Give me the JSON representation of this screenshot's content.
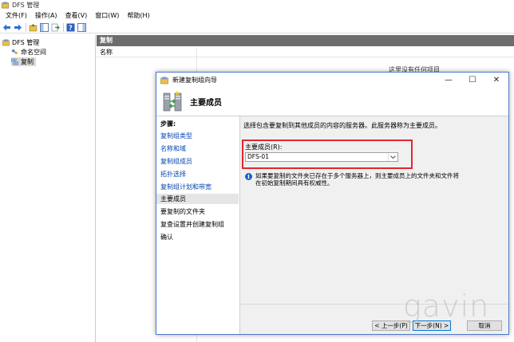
{
  "window": {
    "title": "DFS 管理"
  },
  "menu": [
    {
      "label": "文件(F)"
    },
    {
      "label": "操作(A)"
    },
    {
      "label": "查看(V)"
    },
    {
      "label": "窗口(W)"
    },
    {
      "label": "帮助(H)"
    }
  ],
  "tree": {
    "root": "DFS 管理",
    "items": [
      {
        "label": "命名空间"
      },
      {
        "label": "复制"
      }
    ]
  },
  "right_pane": {
    "header": "复制",
    "column": "名称",
    "background_text": "这里没有任何项目"
  },
  "wizard": {
    "title": "新建复制组向导",
    "page_title": "主要成员",
    "steps_title": "步骤:",
    "steps": [
      {
        "label": "复制组类型",
        "state": "done"
      },
      {
        "label": "名称和域",
        "state": "done"
      },
      {
        "label": "复制组成员",
        "state": "done"
      },
      {
        "label": "拓扑选择",
        "state": "done"
      },
      {
        "label": "复制组计划和带宽",
        "state": "done"
      },
      {
        "label": "主要成员",
        "state": "current"
      },
      {
        "label": "要复制的文件夹",
        "state": "pending"
      },
      {
        "label": "复查设置并创建复制组",
        "state": "pending"
      },
      {
        "label": "确认",
        "state": "pending"
      }
    ],
    "description": "选择包含要复制到其他成员的内容的服务器。此服务器称为主要成员。",
    "field_label": "主要成员(R):",
    "selected_member": "DFS-01",
    "info_text": "如果要复制的文件夹已存在于多个服务器上，则主要成员上的文件夹和文件将在初始复制期间具有权威性。",
    "buttons": {
      "back": "< 上一步(P)",
      "next": "下一步(N) >",
      "cancel": "取消"
    },
    "controls": {
      "minimize": "—",
      "maximize": "☐",
      "close": "✕"
    }
  },
  "watermark": "gavin",
  "colors": {
    "title_bar_header": "#6d6d6d",
    "link_step": "#0645ad",
    "highlight_box": "#e3262f",
    "info_icon": "#1e5fc2"
  }
}
